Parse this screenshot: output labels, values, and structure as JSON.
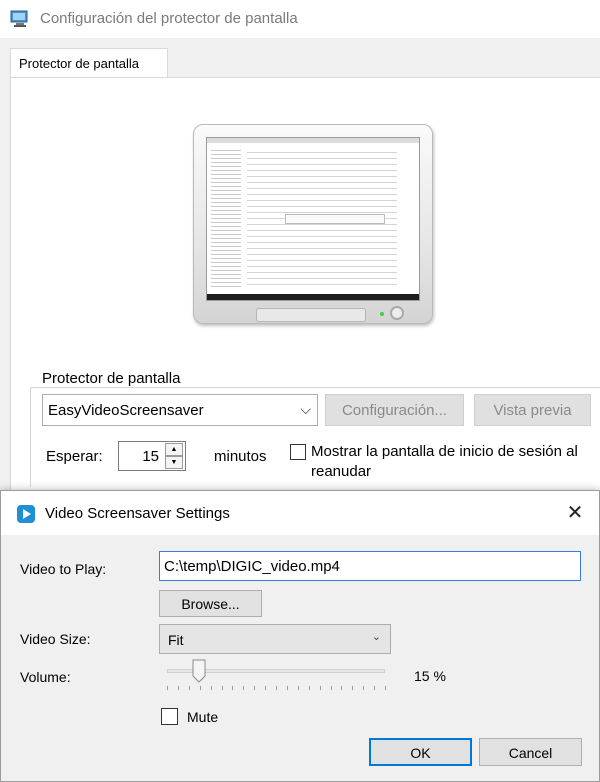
{
  "background_window": {
    "title": "Configuración del protector de pantalla",
    "tab_label": "Protector de pantalla",
    "group_label": "Protector de pantalla",
    "screensaver_selected": "EasyVideoScreensaver",
    "config_button": "Configuración...",
    "preview_button": "Vista previa",
    "wait_label": "Esperar:",
    "wait_value": "15",
    "minutes_label": "minutos",
    "logon_checkbox_label": "Mostrar la pantalla de inicio de sesión al reanudar",
    "logon_checked": false
  },
  "dialog": {
    "title": "Video Screensaver Settings",
    "close_glyph": "✕",
    "video_label": "Video to Play:",
    "video_path": "C:\\temp\\DIGIC_video.mp4",
    "browse_button": "Browse...",
    "size_label": "Video Size:",
    "size_value": "Fit",
    "volume_label": "Volume:",
    "volume_value": "15 %",
    "volume_level": 0.15,
    "mute_label": "Mute",
    "mute_checked": false,
    "ok_button": "OK",
    "cancel_button": "Cancel"
  },
  "icons": {
    "window_icon": "screensaver-monitor-icon",
    "dialog_icon": "video-play-icon",
    "combo_chevron": "chevron-down-icon"
  },
  "colors": {
    "accent": "#0078d7",
    "dialog_icon": "#1f8fd6"
  }
}
